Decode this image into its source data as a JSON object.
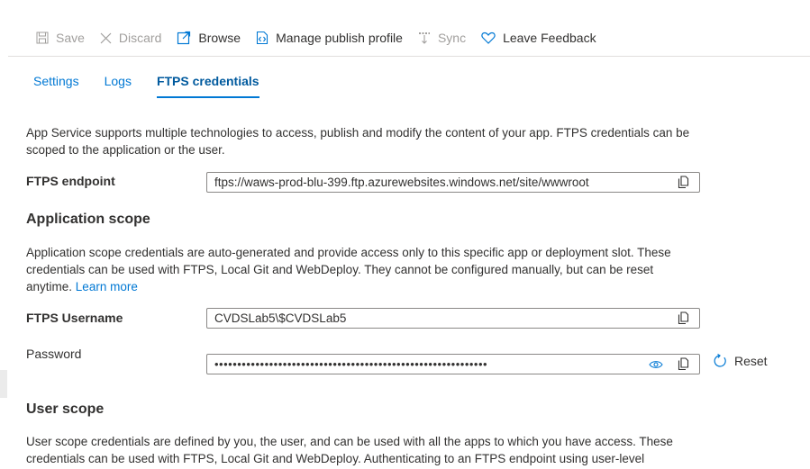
{
  "toolbar": {
    "save": "Save",
    "discard": "Discard",
    "browse": "Browse",
    "manage_publish_profile": "Manage publish profile",
    "sync": "Sync",
    "leave_feedback": "Leave Feedback"
  },
  "tabs": [
    {
      "label": "Settings",
      "active": false
    },
    {
      "label": "Logs",
      "active": false
    },
    {
      "label": "FTPS credentials",
      "active": true
    }
  ],
  "intro": "App Service supports multiple technologies to access, publish and modify the content of your app. FTPS credentials can be scoped to the application or the user.",
  "endpoint": {
    "label": "FTPS endpoint",
    "value": "ftps://waws-prod-blu-399.ftp.azurewebsites.windows.net/site/wwwroot"
  },
  "app_scope": {
    "heading": "Application scope",
    "description": "Application scope credentials are auto-generated and provide access only to this specific app or deployment slot. These credentials can be used with FTPS, Local Git and WebDeploy. They cannot be configured manually, but can be reset anytime.",
    "learn_more": "Learn more",
    "username_label": "FTPS Username",
    "username_value": "CVDSLab5\\$CVDSLab5",
    "password_label": "Password",
    "password_value": "••••••••••••••••••••••••••••••••••••••••••••••••••••••••••••",
    "reset": "Reset"
  },
  "user_scope": {
    "heading": "User scope",
    "description": "User scope credentials are defined by you, the user, and can be used with all the apps to which you have access. These credentials can be used with FTPS, Local Git and WebDeploy. Authenticating to an FTPS endpoint using user-level"
  },
  "colors": {
    "accent": "#0078d4",
    "text": "#323130",
    "disabled": "#a19f9d",
    "border": "#8a8886"
  }
}
